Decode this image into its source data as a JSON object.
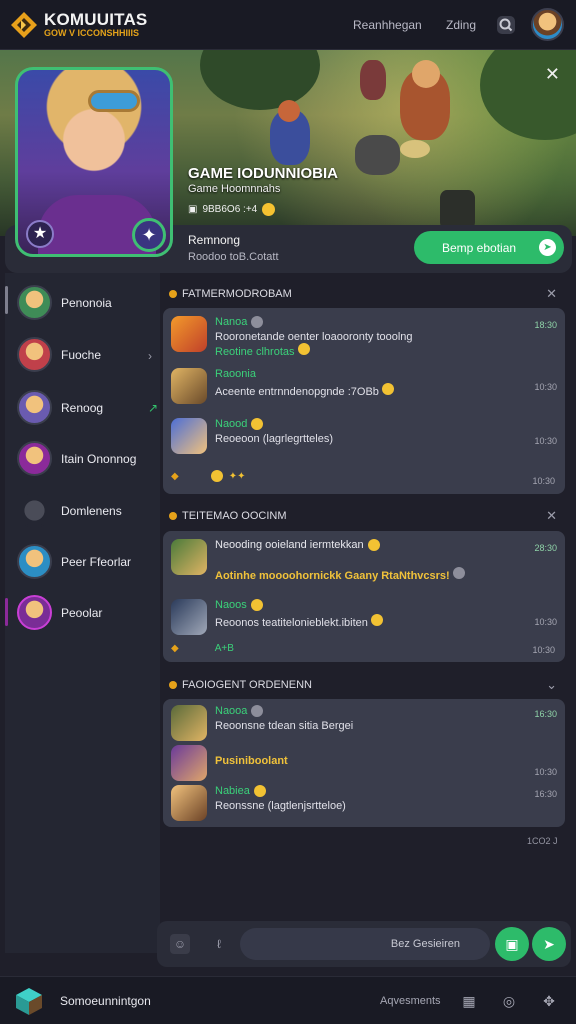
{
  "header": {
    "logo_title": "KOMUUITAS",
    "logo_sub": "GOW V ICCONSHHIIIS",
    "link_1": "Reanhhegan",
    "link_2": "Zding",
    "search_icon": "search-icon",
    "avatar_icon": "avatar"
  },
  "hero": {
    "title": "GAME IODUNNIOBIA",
    "subtitle": "Game  Hoomnnahs",
    "meta": "9BB6O6 :+4"
  },
  "info": {
    "name": "Remnong",
    "description": "Roodoo toB.Cotatt",
    "cta_label": "Bemp ebotian"
  },
  "sidebar": {
    "items": [
      {
        "label": "Penonoia",
        "color": "#3f8c57"
      },
      {
        "label": "Fuoche",
        "color": "#c0404a"
      },
      {
        "label": "Renoog",
        "color": "#6a5bb0"
      },
      {
        "label": "Itain Ononnog",
        "color": "#8b2a9a"
      },
      {
        "label": "Domlenens",
        "color": "#3a3c48"
      },
      {
        "label": "Peer Ffeorlar",
        "color": "#2c8ec4"
      },
      {
        "label": "Peoolar",
        "color": "#7a2d96"
      }
    ]
  },
  "sections": [
    {
      "title": "FATMERMODROBAM",
      "messages": [
        {
          "name": "Nanoa",
          "text": "Rooronetande oenter loaooronty tooolng",
          "text2": "Reotine clhrotas",
          "time": "18:30"
        },
        {
          "name": "Raoonia",
          "text": "Aceente entrnndenopgnde :7OBb",
          "time": "10:30"
        },
        {
          "name": "Naood",
          "text": "Reoeoon  (lagrlegrtteles)",
          "time": "10:30"
        }
      ],
      "reactions_time": "10:30"
    },
    {
      "title": "TEITEMAO OOCINM",
      "messages": [
        {
          "name": "Neooding ooieland iermtekkan",
          "text": "Aotinhe moooohornickk Gaany RtaNthvcsrs!",
          "time": "28:30"
        },
        {
          "name": "Naoos",
          "text": "Reoonos teatitelonieblekt.ibiten",
          "time": "10:30"
        }
      ],
      "reactions_text": "A+B",
      "reactions_time": "10:30"
    },
    {
      "title": "FAOIOGENT ORDENENN",
      "messages": [
        {
          "name": "Naooa",
          "text": "Reoonsne tdean sitia Bergei",
          "time": "16:30"
        },
        {
          "name": "Pusiniboolant",
          "time": "10:30"
        },
        {
          "name": "Nabiea",
          "text": "Reonssne  (lagtlenjsrtteloe)",
          "time": "16:30"
        }
      ]
    }
  ],
  "footer_time": "1CO2 J",
  "composer": {
    "placeholder": "Bez Gesieiren"
  },
  "bottombar": {
    "title": "Somoeunnintgon",
    "link": "Aqvesments"
  }
}
